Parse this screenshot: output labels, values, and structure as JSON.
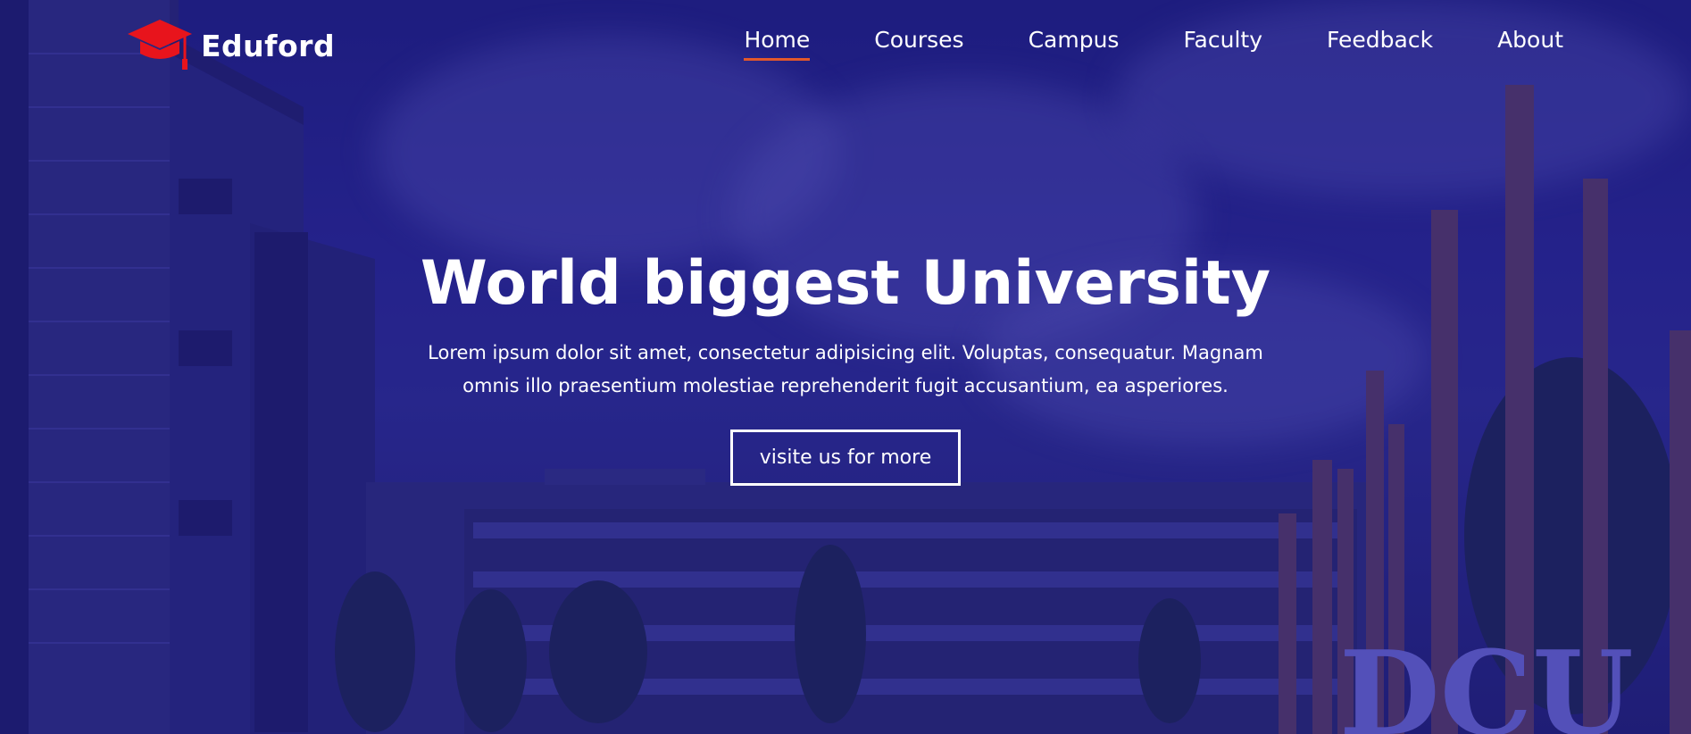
{
  "brand": {
    "name": "Eduford",
    "icon": "graduation-cap-icon",
    "icon_color": "#e8141c"
  },
  "nav": {
    "items": [
      {
        "label": "Home",
        "active": true
      },
      {
        "label": "Courses",
        "active": false
      },
      {
        "label": "Campus",
        "active": false
      },
      {
        "label": "Faculty",
        "active": false
      },
      {
        "label": "Feedback",
        "active": false
      },
      {
        "label": "About",
        "active": false
      }
    ],
    "active_underline_color": "#e2582b"
  },
  "hero": {
    "title": "World biggest University",
    "text": "Lorem ipsum dolor sit amet, consectetur adipisicing elit. Voluptas, consequatur. Magnam omnis illo praesentium molestiae reprehenderit fugit accusantium, ea asperiores.",
    "button_label": "visite us for more",
    "sign_text": "DCU"
  }
}
